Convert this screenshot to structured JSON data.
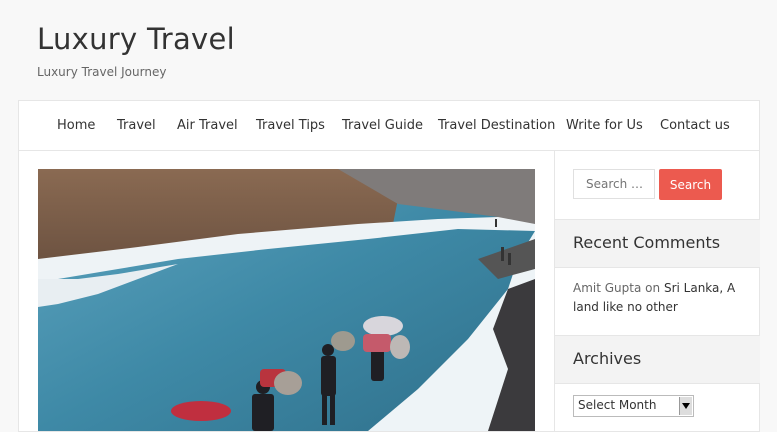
{
  "site": {
    "title": "Luxury Travel",
    "description": "Luxury Travel Journey"
  },
  "nav": {
    "items": [
      {
        "label": "Home"
      },
      {
        "label": "Travel"
      },
      {
        "label": "Air Travel"
      },
      {
        "label": "Travel Tips"
      },
      {
        "label": "Travel Guide"
      },
      {
        "label": "Travel Destination"
      },
      {
        "label": "Write for Us"
      },
      {
        "label": "Contact us"
      }
    ]
  },
  "sidebar": {
    "search": {
      "placeholder": "Search …",
      "button_label": "Search"
    },
    "recent_comments": {
      "title": "Recent Comments",
      "author": "Amit Gupta",
      "connector": "on",
      "post": "Sri Lanka, A land like no other"
    },
    "archives": {
      "title": "Archives",
      "selected": "Select Month"
    }
  },
  "colors": {
    "accent": "#ec5a4f",
    "background": "#f8f8f8"
  }
}
